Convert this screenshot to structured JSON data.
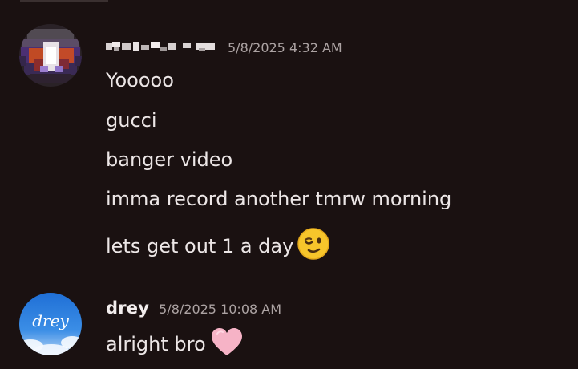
{
  "messages": [
    {
      "author": "",
      "timestamp": "5/8/2025 4:32 AM",
      "lines": [
        "Yooooo",
        "gucci",
        "banger video",
        "imma record another tmrw morning",
        "lets get out 1 a day"
      ],
      "emoji": "winking-face"
    },
    {
      "author": "drey",
      "avatar_text": "drey",
      "timestamp": "5/8/2025 10:08 AM",
      "lines": [
        "alright bro"
      ],
      "emoji": "pink-heart"
    }
  ],
  "colors": {
    "background": "#1a1111",
    "text": "#ece6e6",
    "timestamp": "#aca3a3",
    "heart": "#f6b3c6",
    "wink_face": "#f7c52b"
  }
}
